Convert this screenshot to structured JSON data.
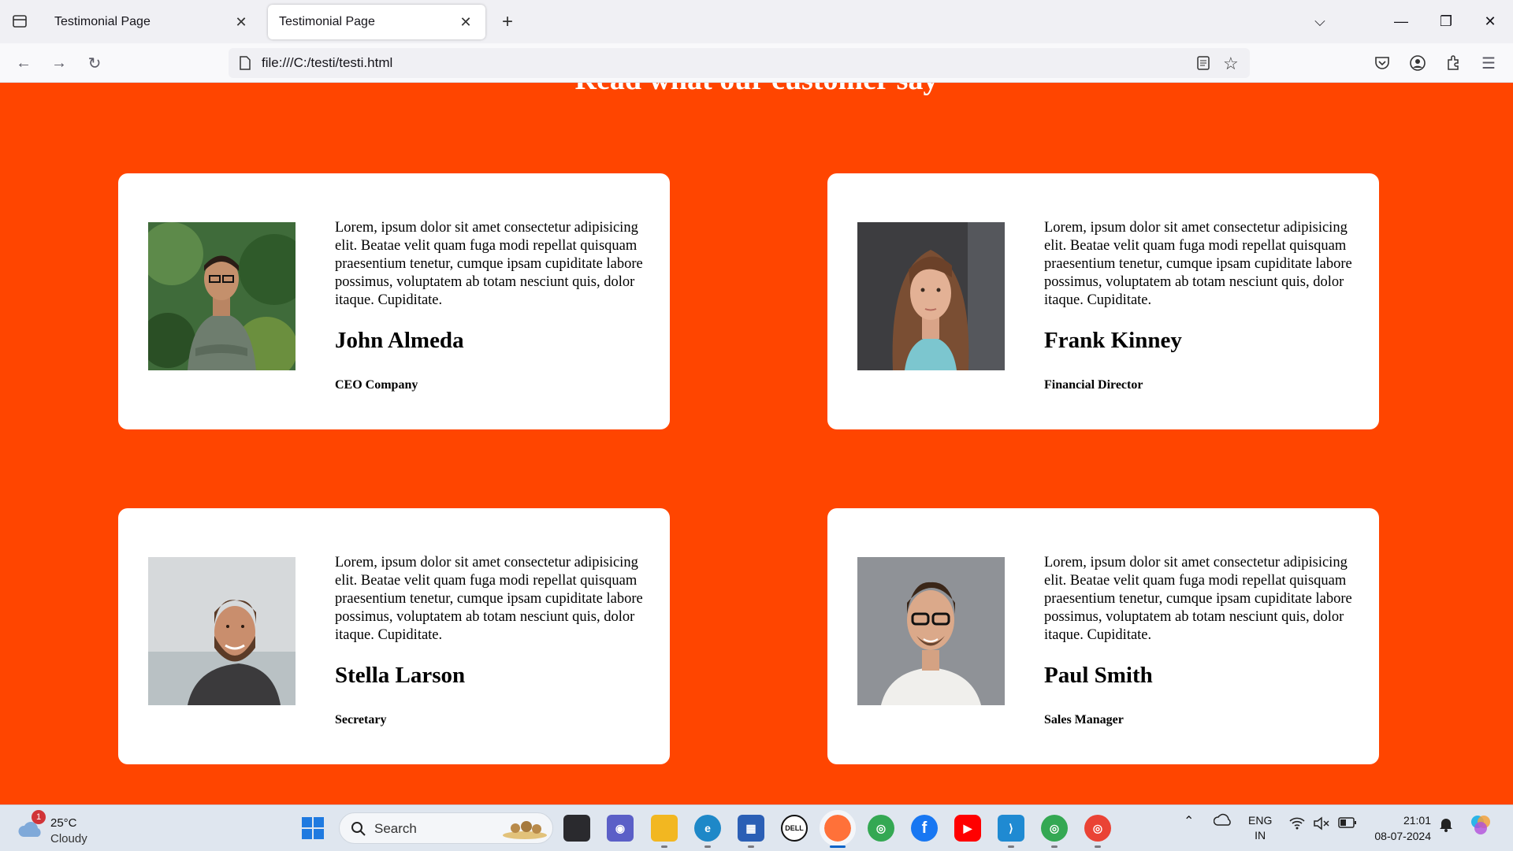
{
  "browser": {
    "tabs": [
      {
        "title": "Testimonial Page"
      },
      {
        "title": "Testimonial Page"
      }
    ],
    "url": "file:///C:/testi/testi.html"
  },
  "page": {
    "heading": "Read what our customer say",
    "testimonials": [
      {
        "text": "Lorem, ipsum dolor sit amet consectetur adipisicing elit. Beatae velit quam fuga modi repellat quisquam praesentium tenetur, cumque ipsam cupiditate labore possimus, voluptatem ab totam nesciunt quis, dolor itaque. Cupiditate.",
        "name": "John Almeda",
        "role": "CEO Company"
      },
      {
        "text": "Lorem, ipsum dolor sit amet consectetur adipisicing elit. Beatae velit quam fuga modi repellat quisquam praesentium tenetur, cumque ipsam cupiditate labore possimus, voluptatem ab totam nesciunt quis, dolor itaque. Cupiditate.",
        "name": "Frank Kinney",
        "role": "Financial Director"
      },
      {
        "text": "Lorem, ipsum dolor sit amet consectetur adipisicing elit. Beatae velit quam fuga modi repellat quisquam praesentium tenetur, cumque ipsam cupiditate labore possimus, voluptatem ab totam nesciunt quis, dolor itaque. Cupiditate.",
        "name": "Stella Larson",
        "role": "Secretary"
      },
      {
        "text": "Lorem, ipsum dolor sit amet consectetur adipisicing elit. Beatae velit quam fuga modi repellat quisquam praesentium tenetur, cumque ipsam cupiditate labore possimus, voluptatem ab totam nesciunt quis, dolor itaque. Cupiditate.",
        "name": "Paul Smith",
        "role": "Sales Manager"
      }
    ],
    "background_color": "#ff4500"
  },
  "taskbar": {
    "weather": {
      "temp": "25°C",
      "condition": "Cloudy",
      "badge": "1"
    },
    "search_label": "Search",
    "language": {
      "line1": "ENG",
      "line2": "IN"
    },
    "clock": {
      "time": "21:01",
      "date": "08-07-2024"
    }
  }
}
